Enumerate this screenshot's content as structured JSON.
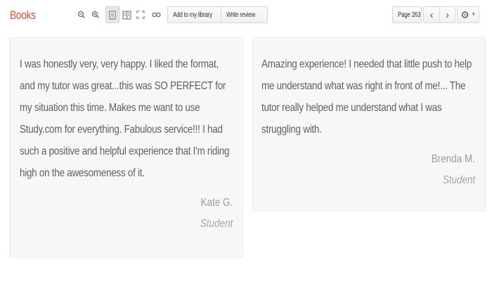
{
  "header": {
    "brand": "Books",
    "add_to_library": "Add to my library",
    "write_review": "Write review",
    "page_selector": "Page 263",
    "icons": [
      "zoom-out-icon",
      "zoom-in-icon",
      "single-page-icon",
      "two-page-icon",
      "fullscreen-icon",
      "link-icon",
      "prev-page-icon",
      "next-page-icon",
      "gear-icon"
    ]
  },
  "testimonials": [
    {
      "quote": "I was honestly very, very happy. I liked the format, and my tutor was great...this was SO PERFECT for my situation this time. Makes me want to use Study.com for everything. Fabulous service!!! I had such a positive and helpful experience that I'm riding high on the awesomeness of it.",
      "author": "Kate G.",
      "role": "Student"
    },
    {
      "quote": "Amazing experience! I needed that little push to help me understand what was right in front of me!... The tutor really helped me understand what I was struggling with.",
      "author": "Brenda M.",
      "role": "Student"
    }
  ],
  "colors": {
    "brand": "#dd4b39",
    "card_background": "#f7f7f7"
  }
}
